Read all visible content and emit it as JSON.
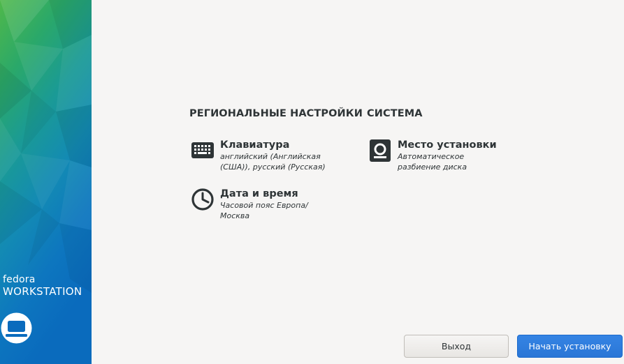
{
  "sidebar": {
    "brand_small": "fedora",
    "brand_large": "WORKSTATION",
    "logo_icon": "laptop-icon"
  },
  "sections": {
    "localization": {
      "title": "РЕГИОНАЛЬНЫЕ НАСТРОЙКИ",
      "keyboard": {
        "icon": "keyboard-icon",
        "title": "Клавиатура",
        "status": "английский (Английская (США)), русский (Русская)"
      },
      "datetime": {
        "icon": "clock-icon",
        "title": "Дата и время",
        "status": "Часовой пояс Европа/Москва"
      }
    },
    "system": {
      "title": "СИСТЕМА",
      "destination": {
        "icon": "disk-icon",
        "title": "Место установки",
        "status": "Автоматическое разбиение диска"
      }
    }
  },
  "buttons": {
    "quit": "Выход",
    "begin": "Начать установку"
  },
  "colors": {
    "primary": "#3584e4",
    "text": "#2e3436",
    "background": "#f6f5f4"
  }
}
